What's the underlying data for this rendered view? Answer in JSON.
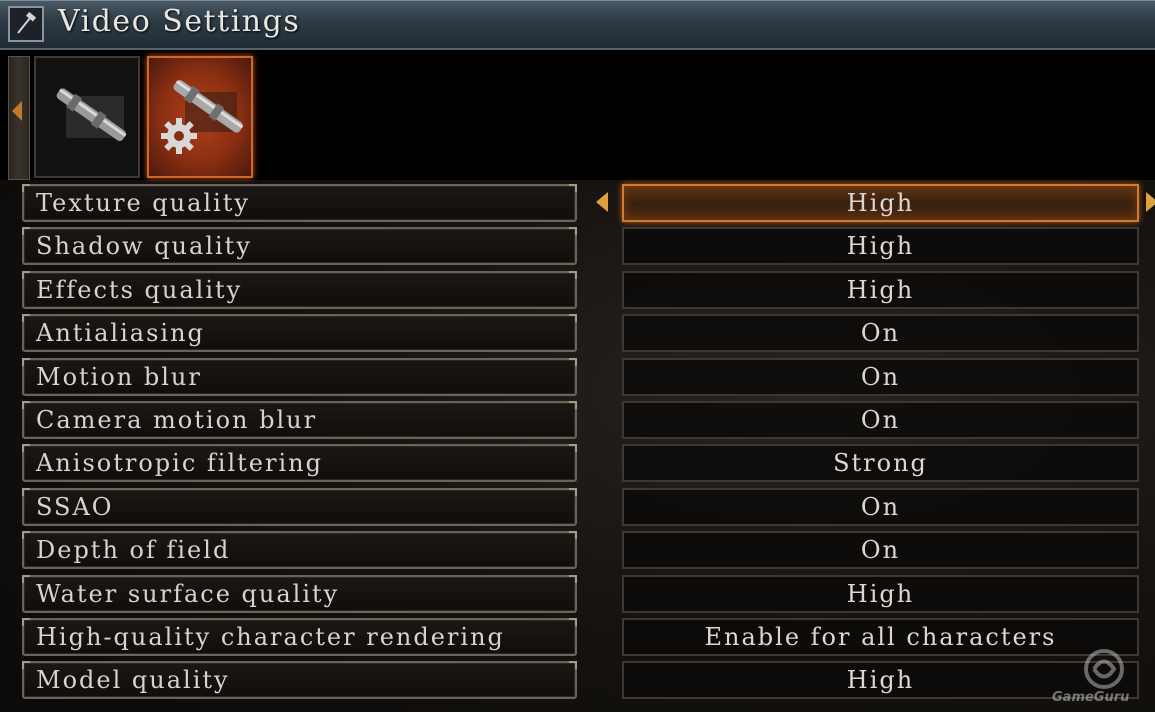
{
  "window": {
    "title": "Video Settings",
    "icon": "hammer-icon"
  },
  "tabs": [
    {
      "icon": "binoculars-icon",
      "selected": false
    },
    {
      "icon": "binoculars-gear-icon",
      "selected": true
    }
  ],
  "settings": [
    {
      "label": "Texture quality",
      "value": "High",
      "selected": true
    },
    {
      "label": "Shadow quality",
      "value": "High",
      "selected": false
    },
    {
      "label": "Effects quality",
      "value": "High",
      "selected": false
    },
    {
      "label": "Antialiasing",
      "value": "On",
      "selected": false
    },
    {
      "label": "Motion blur",
      "value": "On",
      "selected": false
    },
    {
      "label": "Camera motion blur",
      "value": "On",
      "selected": false
    },
    {
      "label": "Anisotropic filtering",
      "value": "Strong",
      "selected": false
    },
    {
      "label": "SSAO",
      "value": "On",
      "selected": false
    },
    {
      "label": "Depth of field",
      "value": "On",
      "selected": false
    },
    {
      "label": "Water surface quality",
      "value": "High",
      "selected": false
    },
    {
      "label": "High-quality character rendering",
      "value": "Enable for all characters",
      "selected": false
    },
    {
      "label": "Model quality",
      "value": "High",
      "selected": false
    }
  ],
  "watermark": {
    "text": "GameGuru"
  },
  "colors": {
    "accent": "#d47a2c",
    "selected_tab": "#b2421c",
    "text": "#d8d4cb"
  }
}
